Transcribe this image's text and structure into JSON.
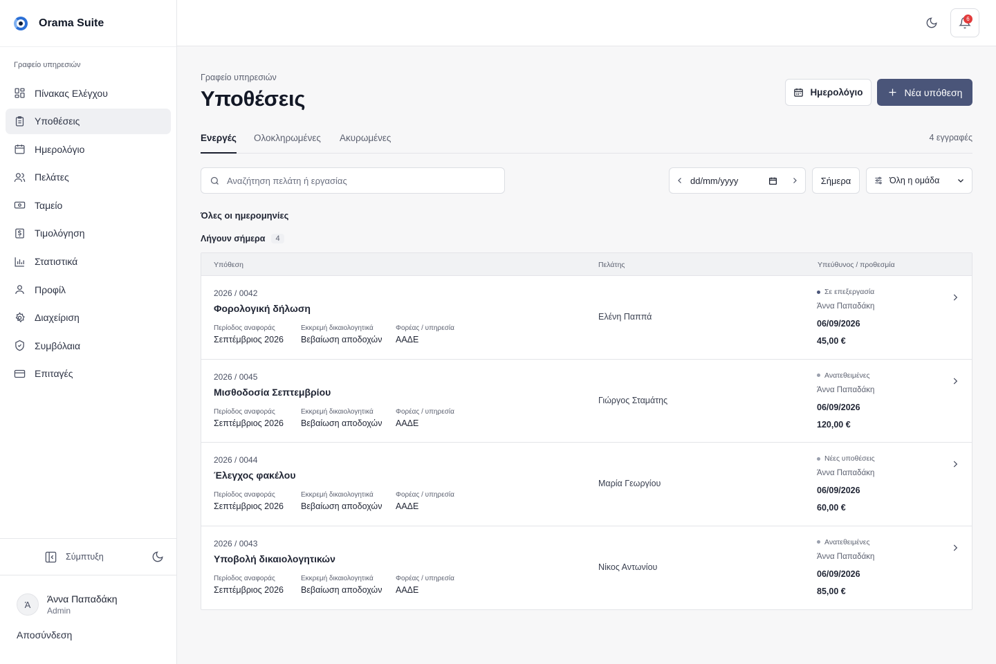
{
  "app": {
    "name": "Orama Suite"
  },
  "sidebar": {
    "section": "Γραφείο υπηρεσιών",
    "items": [
      {
        "label": "Πίνακας Ελέγχου",
        "icon": "dashboard-icon"
      },
      {
        "label": "Υποθέσεις",
        "icon": "clipboard-icon",
        "active": true
      },
      {
        "label": "Ημερολόγιο",
        "icon": "calendar-icon"
      },
      {
        "label": "Πελάτες",
        "icon": "users-icon"
      },
      {
        "label": "Ταμείο",
        "icon": "cash-icon"
      },
      {
        "label": "Τιμολόγηση",
        "icon": "invoice-icon"
      },
      {
        "label": "Στατιστικά",
        "icon": "bar-chart-icon"
      },
      {
        "label": "Προφίλ",
        "icon": "user-icon"
      },
      {
        "label": "Διαχείριση",
        "icon": "gear-icon"
      },
      {
        "label": "Συμβόλαια",
        "icon": "shield-icon"
      },
      {
        "label": "Επιταγές",
        "icon": "credit-card-icon"
      }
    ],
    "collapse_label": "Σύμπτυξη",
    "user": {
      "initial": "Ά",
      "name": "Άννα Παπαδάκη",
      "role": "Admin"
    },
    "logout_label": "Αποσύνδεση"
  },
  "topbar": {
    "notifications_count": "6"
  },
  "page": {
    "breadcrumb": "Γραφείο υπηρεσιών",
    "title": "Υποθέσεις",
    "calendar_button": "Ημερολόγιο",
    "new_button": "Νέα υπόθεση",
    "tabs": [
      "Ενεργές",
      "Ολοκληρωμένες",
      "Ακυρωμένες"
    ],
    "record_count": "4 εγγραφές",
    "search_placeholder": "Αναζήτηση πελάτη ή εργασίας",
    "date_placeholder": "dd/mm/yyyy",
    "today_button": "Σήμερα",
    "group_select": "Όλη η ομάδα",
    "all_dates_label": "Όλες οι ημερομηνίες",
    "due_today_label": "Λήγουν σήμερα",
    "due_today_count": "4"
  },
  "table": {
    "headers": [
      "Υπόθεση",
      "Πελάτης",
      "Υπεύθυνος / προθεσμία"
    ],
    "meta_labels": [
      "Περίοδος αναφοράς",
      "Εκκρεμή δικαιολογητικά",
      "Φορέας / υπηρεσία"
    ],
    "rows": [
      {
        "number": "2026 / 0042",
        "title": "Φορολογική δήλωση",
        "period": "Σεπτέμβριος 2026",
        "docs": "Βεβαίωση αποδοχών",
        "agency": "ΑΑΔΕ",
        "client": "Ελένη Παππά",
        "status": "Σε επεξεργασία",
        "owner": "Άννα Παπαδάκη",
        "date": "06/09/2026",
        "amount": "45,00 €"
      },
      {
        "number": "2026 / 0045",
        "title": "Μισθοδοσία Σεπτεμβρίου",
        "period": "Σεπτέμβριος 2026",
        "docs": "Βεβαίωση αποδοχών",
        "agency": "ΑΑΔΕ",
        "client": "Γιώργος Σταμάτης",
        "status": "Ανατεθειμένες",
        "owner": "Άννα Παπαδάκη",
        "date": "06/09/2026",
        "amount": "120,00 €"
      },
      {
        "number": "2026 / 0044",
        "title": "Έλεγχος φακέλου",
        "period": "Σεπτέμβριος 2026",
        "docs": "Βεβαίωση αποδοχών",
        "agency": "ΑΑΔΕ",
        "client": "Μαρία Γεωργίου",
        "status": "Νέες υποθέσεις",
        "owner": "Άννα Παπαδάκη",
        "date": "06/09/2026",
        "amount": "60,00 €"
      },
      {
        "number": "2026 / 0043",
        "title": "Υποβολή δικαιολογητικών",
        "period": "Σεπτέμβριος 2026",
        "docs": "Βεβαίωση αποδοχών",
        "agency": "ΑΑΔΕ",
        "client": "Νίκος Αντωνίου",
        "status": "Ανατεθειμένες",
        "owner": "Άννα Παπαδάκη",
        "date": "06/09/2026",
        "amount": "85,00 €"
      }
    ]
  },
  "colors": {
    "primary": "#4a5579",
    "badge": "#e23b3b",
    "active_nav": "#eff0f3"
  }
}
